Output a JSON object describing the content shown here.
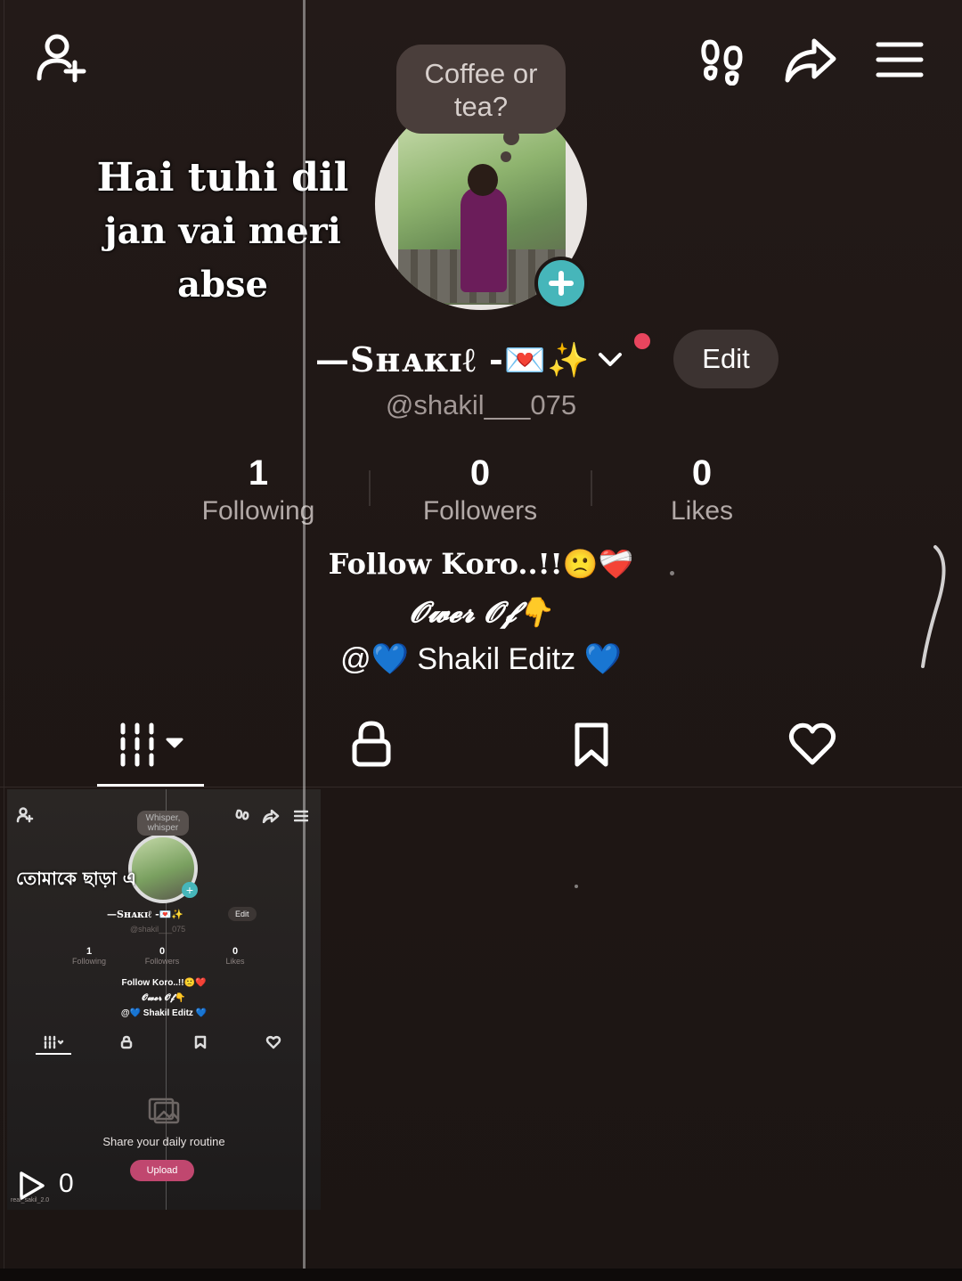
{
  "profile": {
    "bubble_text": "Coffee or tea?",
    "overlay_line1": "Hai tuhi dil",
    "overlay_line2": "jan vai meri abse",
    "display_name": "—Sʜᴀᴋɪℓ -💌✨",
    "edit_label": "Edit",
    "username": "@shakil___075"
  },
  "stats": [
    {
      "value": "1",
      "label": "Following"
    },
    {
      "value": "0",
      "label": "Followers"
    },
    {
      "value": "0",
      "label": "Likes"
    }
  ],
  "bio": {
    "line1": "Follow Koro..!!🙁❤️‍🩹",
    "line2": "𝓞𝔀𝓮𝓻 𝓞𝓯👇",
    "line3": "@💙 Shakil Editz 💙"
  },
  "header_icons": [
    "add-friend-icon",
    "footprints-icon",
    "share-icon",
    "menu-icon"
  ],
  "tabs": [
    "videos-grid-icon",
    "lock-icon",
    "bookmark-icon",
    "heart-icon"
  ],
  "thumbnail": {
    "bubble_text": "Whisper, whisper",
    "overlay_text": "তোমাকে ছাড়া এ",
    "display_name": "—Sʜᴀᴋɪℓ -💌✨",
    "edit_label": "Edit",
    "username": "@shakil___075",
    "stats": [
      {
        "value": "1",
        "label": "Following"
      },
      {
        "value": "0",
        "label": "Followers"
      },
      {
        "value": "0",
        "label": "Likes"
      }
    ],
    "bio_line1": "Follow Koro..!!🙁❤️",
    "bio_line2": "𝓞𝔀𝓮𝓻 𝓞𝓯👇",
    "bio_line3": "@💙 Shakil Editz 💙",
    "share_text": "Share your daily routine",
    "upload_label": "Upload",
    "view_count": "0",
    "watermark": "real_sakil_2.0"
  },
  "colors": {
    "background": "#1f1715",
    "accent_teal": "#46b6ba",
    "notification_red": "#e8455e",
    "upload_pink": "#c0476f"
  }
}
